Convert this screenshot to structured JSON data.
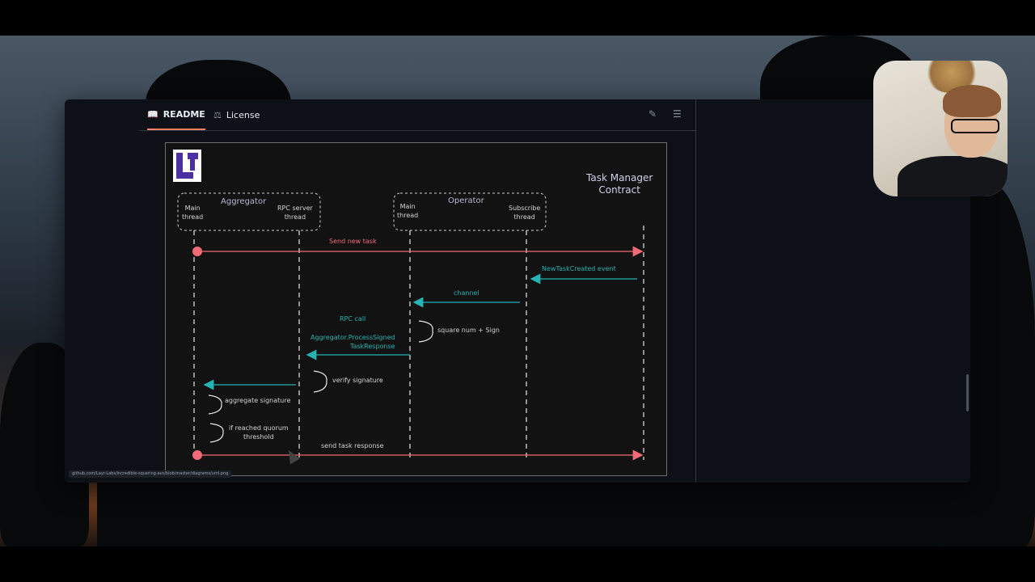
{
  "readme_panel": {
    "tabs": [
      {
        "label": "README",
        "icon": "book-icon",
        "active": true
      },
      {
        "label": "License",
        "icon": "scale-icon",
        "active": false
      }
    ],
    "tools": [
      {
        "icon": "pencil-icon"
      },
      {
        "icon": "list-icon"
      }
    ]
  },
  "diagram": {
    "title": "Task Manager\nContract",
    "groups": [
      {
        "name": "Aggregator",
        "threads": [
          "Main\nthread",
          "RPC server\nthread"
        ]
      },
      {
        "name": "Operator",
        "threads": [
          "Main\nthread",
          "Subscribe\nthread"
        ]
      }
    ],
    "messages": [
      {
        "label": "Send new task",
        "color": "pink"
      },
      {
        "label": "NewTaskCreated event",
        "color": "teal"
      },
      {
        "label": "channel",
        "color": "teal"
      },
      {
        "label": "RPC call",
        "color": "teal"
      },
      {
        "label": "Aggregator.ProcessSigned\nTaskResponse",
        "color": "teal"
      },
      {
        "label": "send task response",
        "color": "white"
      }
    ],
    "self_notes": [
      "square num + Sign",
      "verify signature",
      "aggregate signature",
      "if reached quorum\nthreshold"
    ]
  },
  "statusbar": {
    "url": "github.com/Layr-Labs/incredible-squaring-avs/blob/master/diagrams/uml.png"
  },
  "colors": {
    "pink": "#f26a75",
    "teal": "#26b3b3",
    "tab_underline": "#f78166"
  }
}
